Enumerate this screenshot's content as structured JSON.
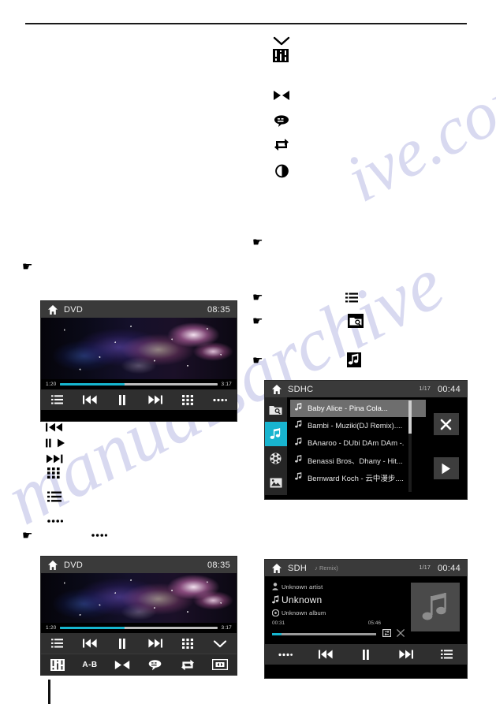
{
  "page": {
    "watermark_a": "ive.com",
    "watermark_b": "manualsarchive"
  },
  "doc_icons": {
    "chevron_down": "chevron-down-icon",
    "equalizer": "equalizer-icon",
    "goto_zoom": "goto-icon",
    "subtitle": "subtitle-icon",
    "repeat": "repeat-icon",
    "brightness": "brightness-icon",
    "prev_track": "prev-track-icon",
    "play_pause": "play-pause-icon",
    "next_track": "next-track-icon",
    "keypad": "keypad-icon",
    "list": "list-icon",
    "more_dots": "more-dots-icon",
    "folder_search": "folder-search-icon",
    "music_note": "music-note-icon"
  },
  "dvd_player_top": {
    "name": "DVD",
    "home_icon": "home-icon",
    "title": "DVD",
    "clock": "08:35",
    "progress": {
      "elapsed": "1:20",
      "total": "3:17",
      "percent": 41
    },
    "controls": [
      {
        "name": "list-button",
        "icon": "list-icon"
      },
      {
        "name": "previous-button",
        "icon": "prev-track-icon"
      },
      {
        "name": "pause-button",
        "icon": "pause-icon"
      },
      {
        "name": "next-button",
        "icon": "next-track-icon"
      },
      {
        "name": "keypad-button",
        "icon": "keypad-icon"
      },
      {
        "name": "more-button",
        "icon": "more-dots-icon"
      }
    ]
  },
  "dvd_player_bottom": {
    "name": "DVD",
    "home_icon": "home-icon",
    "title": "DVD",
    "clock": "08:35",
    "progress": {
      "elapsed": "1:20",
      "total": "3:17",
      "percent": 41
    },
    "controls_row1": [
      {
        "name": "list-button",
        "icon": "list-icon"
      },
      {
        "name": "previous-button",
        "icon": "prev-track-icon"
      },
      {
        "name": "pause-button",
        "icon": "pause-icon"
      },
      {
        "name": "next-button",
        "icon": "next-track-icon"
      },
      {
        "name": "keypad-button",
        "icon": "keypad-icon"
      },
      {
        "name": "collapse-button",
        "icon": "chevron-down-icon"
      }
    ],
    "controls_row2": [
      {
        "name": "equalizer-button",
        "icon": "equalizer-icon",
        "label": ""
      },
      {
        "name": "ab-repeat-button",
        "icon": "text",
        "label": "A-B"
      },
      {
        "name": "goto-button",
        "icon": "goto-icon",
        "label": ""
      },
      {
        "name": "subtitle-button",
        "icon": "subtitle-icon",
        "label": ""
      },
      {
        "name": "repeat-button",
        "icon": "repeat-icon",
        "label": ""
      },
      {
        "name": "screen-button",
        "icon": "screen-icon",
        "label": ""
      }
    ]
  },
  "sdhc_browser": {
    "home_icon": "home-icon",
    "title": "SDHC",
    "index": "1/17",
    "clock": "00:44",
    "rail": [
      {
        "name": "sidebar-item-folder",
        "icon": "folder-search-icon",
        "active": false
      },
      {
        "name": "sidebar-item-music",
        "icon": "music-note-icon",
        "active": true
      },
      {
        "name": "sidebar-item-video",
        "icon": "film-icon",
        "active": false
      },
      {
        "name": "sidebar-item-photo",
        "icon": "photo-icon",
        "active": false
      }
    ],
    "tracks": [
      {
        "title": "Baby Alice - Pina Cola...",
        "selected": true
      },
      {
        "title": "Bambi - Muziki(DJ Remix)....",
        "selected": false
      },
      {
        "title": "BAnaroo - DUbi DAm DAm -.",
        "selected": false
      },
      {
        "title": "Benassi Bros、Dhany - Hit...",
        "selected": false
      },
      {
        "title": "Bernward Koch - 云中漫步....",
        "selected": false
      }
    ],
    "buttons": [
      {
        "name": "close-button",
        "icon": "close-icon"
      },
      {
        "name": "play-button",
        "icon": "play-icon"
      }
    ]
  },
  "sdh_now_playing": {
    "home_icon": "home-icon",
    "title": "SDH",
    "subtitle": "♪ Remix)",
    "index": "1/17",
    "clock": "00:44",
    "artist": "Unknown artist",
    "track": "Unknown",
    "album": "Unknown album",
    "artist_icon": "person-icon",
    "track_icon": "music-note-icon",
    "album_icon": "disc-icon",
    "album_art_icon": "music-note-icon",
    "progress": {
      "elapsed": "00:31",
      "total": "05:46",
      "percent": 9
    },
    "mini_buttons": [
      {
        "name": "repeat-mode-button",
        "icon": "repeat-icon"
      },
      {
        "name": "shuffle-button",
        "icon": "shuffle-icon"
      }
    ],
    "controls": [
      {
        "name": "more-button",
        "icon": "more-dots-icon"
      },
      {
        "name": "previous-button",
        "icon": "prev-track-icon"
      },
      {
        "name": "pause-button",
        "icon": "pause-icon"
      },
      {
        "name": "next-button",
        "icon": "next-track-icon"
      },
      {
        "name": "list-button",
        "icon": "list-icon"
      }
    ]
  },
  "colors": {
    "accent": "#16b6cf",
    "rail_active": "#18b4cf",
    "header_bg": "#3a3a3a",
    "control_bg": "#2f2f2f"
  }
}
